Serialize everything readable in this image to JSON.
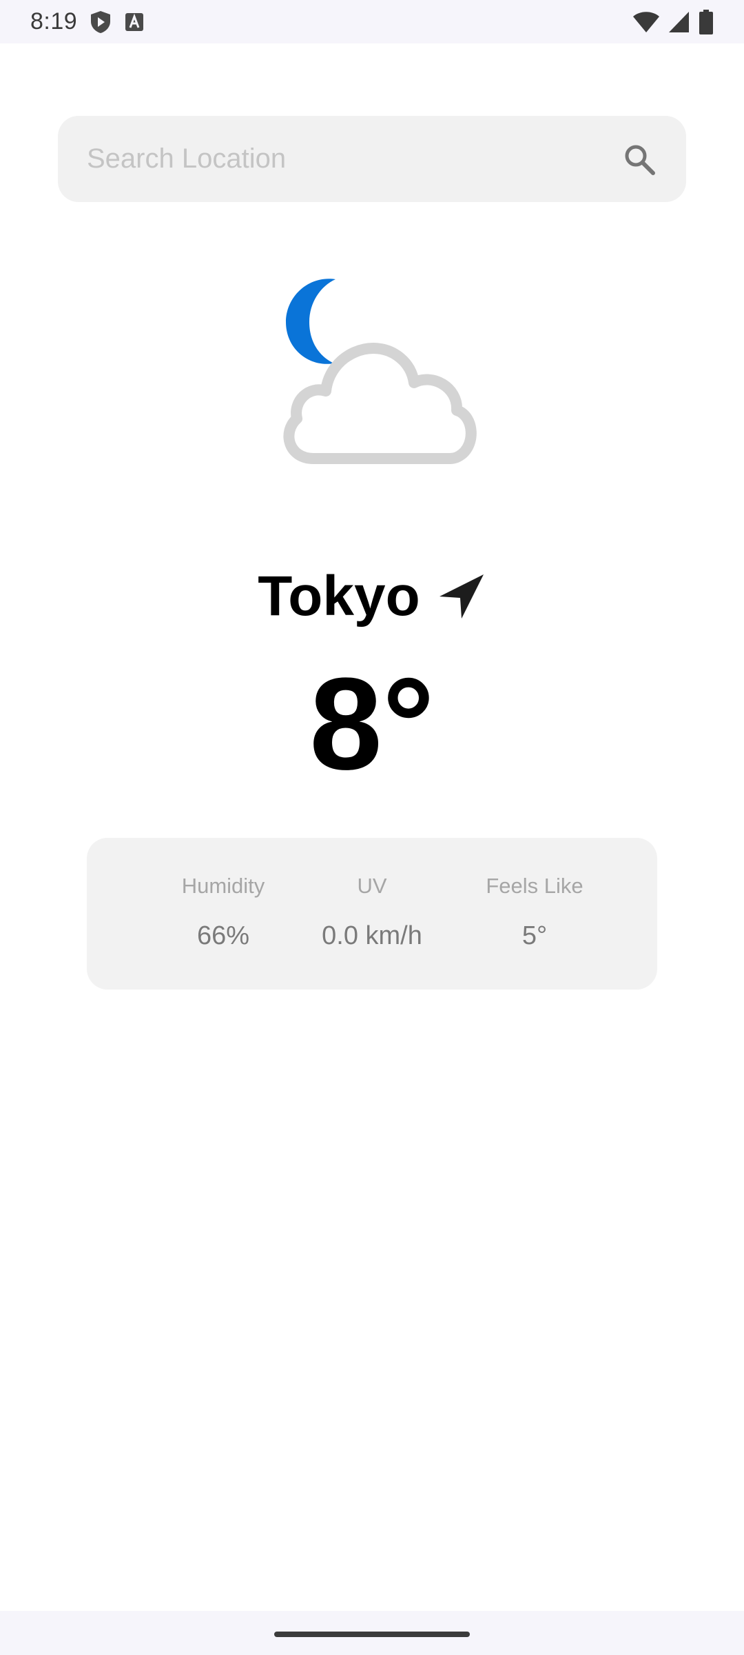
{
  "status_bar": {
    "time": "8:19",
    "icons": [
      "shield-play-icon",
      "keyboard-a-icon",
      "wifi-icon",
      "signal-icon",
      "battery-icon"
    ]
  },
  "search": {
    "placeholder": "Search Location",
    "value": "",
    "icon": "search-icon"
  },
  "weather": {
    "condition_icon": "moon-cloud-icon",
    "moon_color": "#0a74d8",
    "cloud_color": "#d3d3d3",
    "city": "Tokyo",
    "location_icon": "navigation-arrow-icon",
    "temperature": "8°"
  },
  "details": {
    "humidity_label": "Humidity",
    "humidity_value": "66%",
    "uv_label": "UV",
    "uv_value": "0.0 km/h",
    "feels_like_label": "Feels Like",
    "feels_like_value": "5°"
  }
}
